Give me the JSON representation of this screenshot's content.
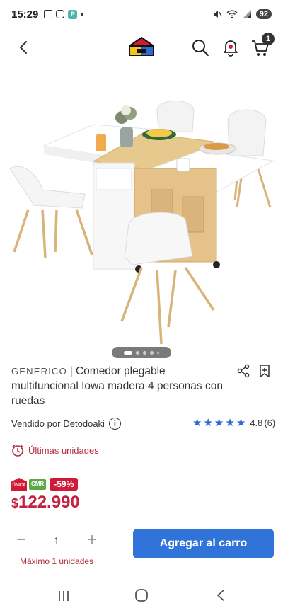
{
  "status_bar": {
    "time": "15:29",
    "battery": "92"
  },
  "header": {
    "cart_count": "1"
  },
  "product": {
    "brand": "GENERICO",
    "separator": "|",
    "title": "Comedor plegable multifuncional Iowa madera 4 personas con ruedas",
    "seller_prefix": "Vendido por",
    "seller_name": "Detodoaki",
    "rating_value": "4.8",
    "rating_count": "(6)",
    "rating_stars": 5,
    "stock_label": "Últimas unidades",
    "badge_unica": "ÚNICA",
    "badge_cmr": "CMR",
    "discount": "-59%",
    "price_currency": "$",
    "price": "122.990"
  },
  "purchase": {
    "quantity": "1",
    "minus_label": "−",
    "plus_label": "+",
    "limit_text": "Máximo 1 unidades",
    "add_to_cart_label": "Agregar al carro"
  },
  "carousel": {
    "active_index": 0,
    "total": 5
  },
  "colors": {
    "accent_blue": "#3073d9",
    "price_red": "#c4203f",
    "star_blue": "#2f6bcf",
    "stock_red": "#b0303f"
  }
}
